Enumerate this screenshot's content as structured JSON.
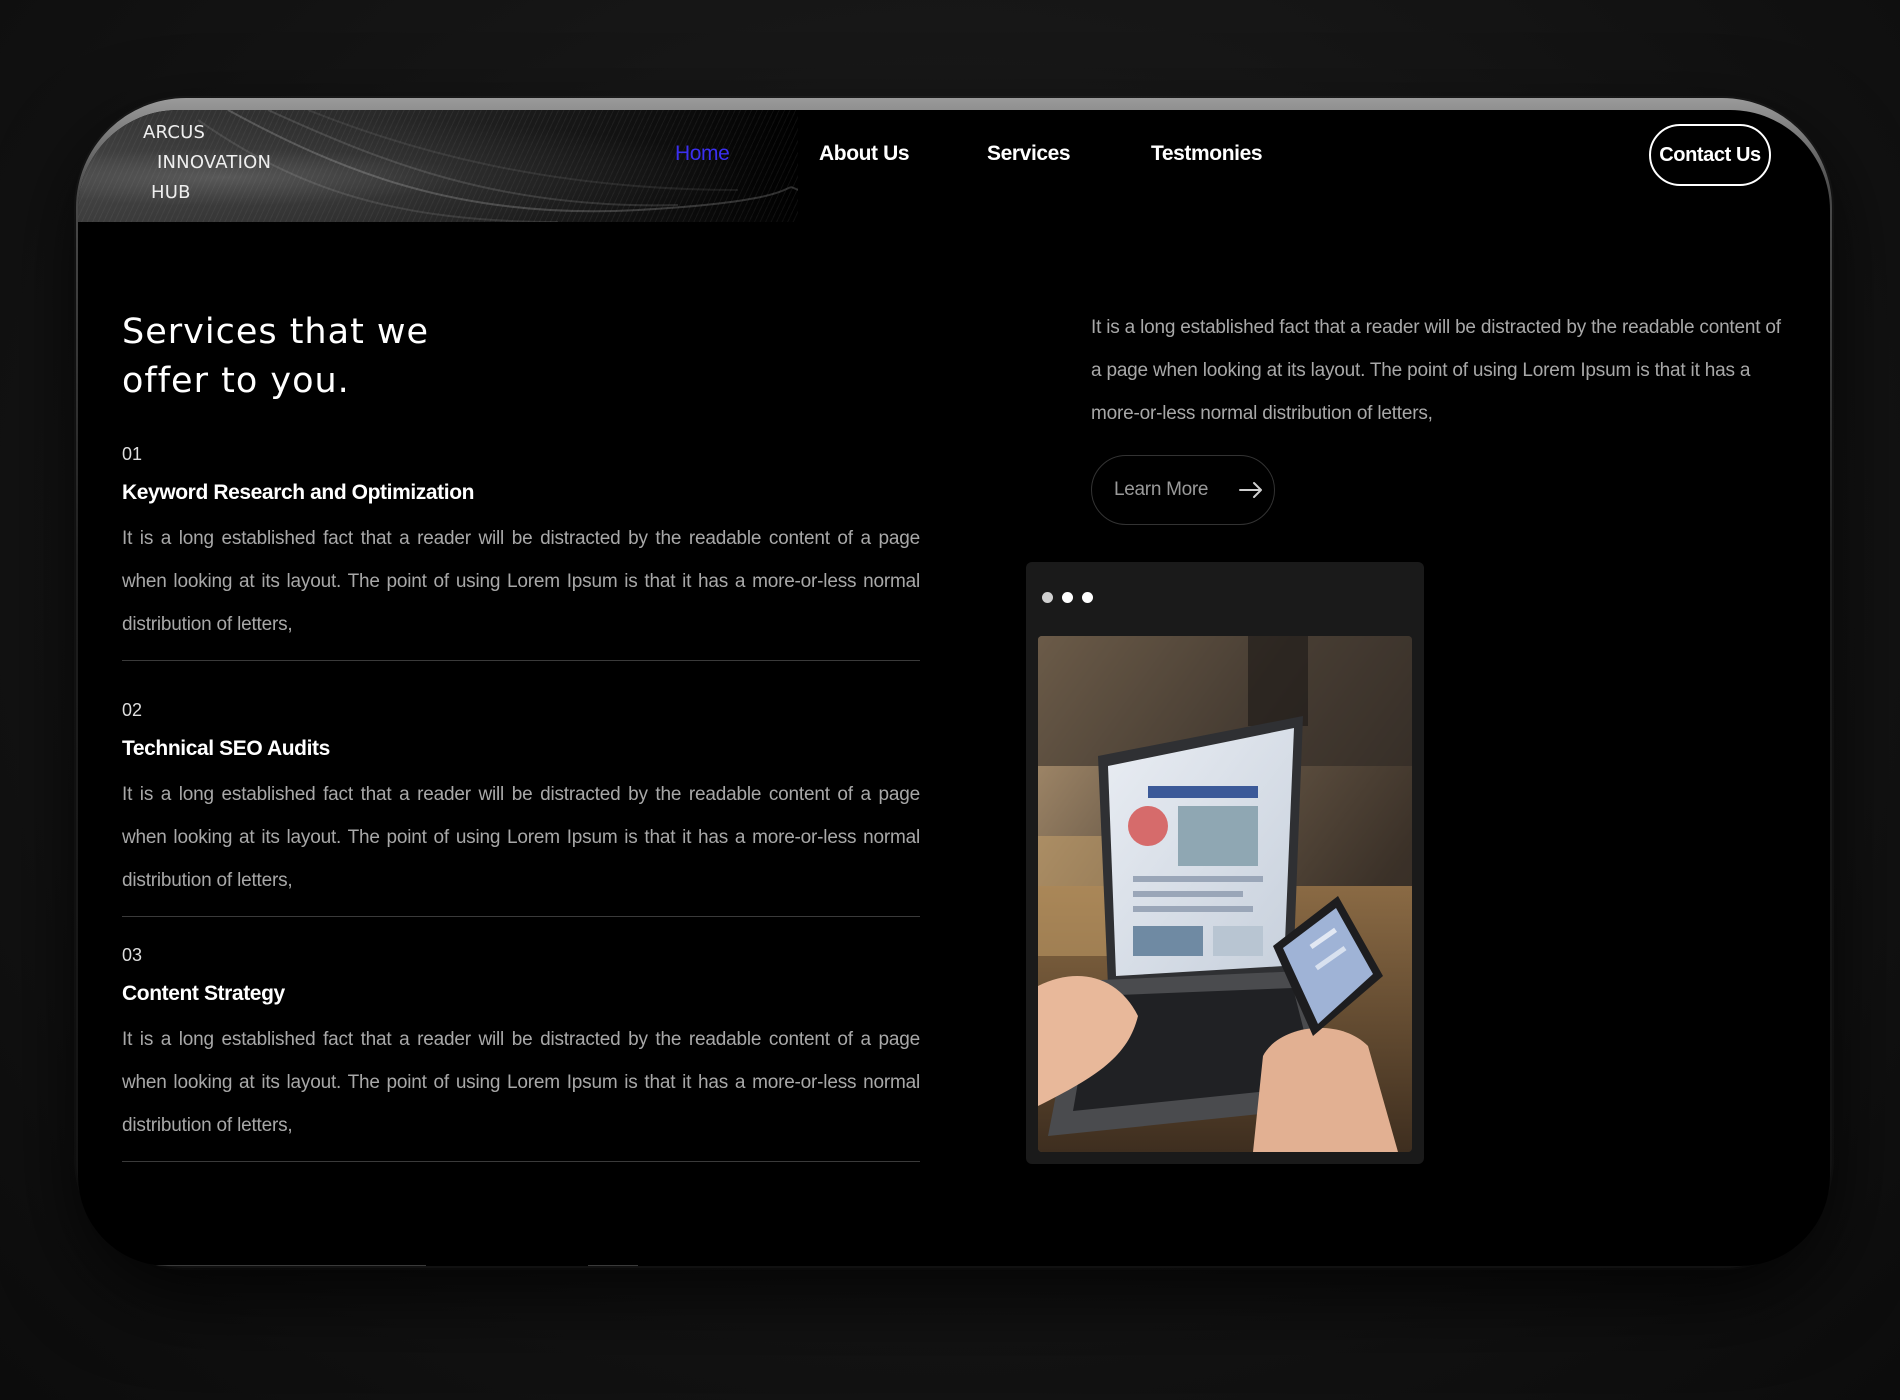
{
  "header": {
    "logo_lines": [
      "ARCUS",
      "INNOVATION",
      "HUB"
    ],
    "nav": [
      "Home",
      "About Us",
      "Services",
      "Testmonies"
    ],
    "active_nav": "Home",
    "contact_label": "Contact Us"
  },
  "main": {
    "heading": "Services that we offer to you.",
    "services": [
      {
        "number": "01",
        "title": "Keyword Research and Optimization",
        "description": "It is a long established fact that a reader will be distracted by the readable content of a page when looking at its layout. The point of using Lorem Ipsum is that it has a more-or-less normal distribution of letters,"
      },
      {
        "number": "02",
        "title": "Technical SEO Audits",
        "description": "It is a long established fact that a reader will be distracted by the readable content of a page when looking at its layout. The point of using Lorem Ipsum is that it has a more-or-less normal distribution of letters,"
      },
      {
        "number": "03",
        "title": "Content Strategy",
        "description": "It is a long established fact that a reader will be distracted by the readable content of a page when looking at its layout. The point of using Lorem Ipsum is that it has a more-or-less normal distribution of letters,"
      }
    ],
    "intro": "It is a long established fact that a reader will be distracted by the readable content of a page when looking at its layout. The point of using Lorem Ipsum is that it has a more-or-less normal distribution of letters,",
    "learn_more_label": "Learn More"
  },
  "colors": {
    "background": "#000000",
    "active_nav": "#3b2ff0",
    "body_text": "#a8a8a8",
    "card": "#1a1a1a"
  },
  "icons": [
    "arrow-right-icon",
    "window-dots-icon"
  ]
}
